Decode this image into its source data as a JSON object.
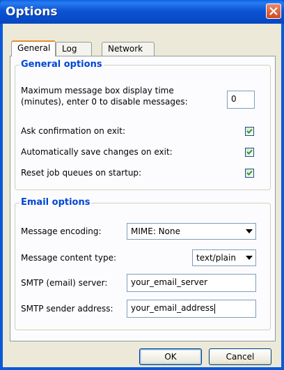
{
  "window": {
    "title": "Options"
  },
  "tabs": [
    {
      "label": "General",
      "active": true
    },
    {
      "label": "Log",
      "active": false
    },
    {
      "label": "Network",
      "active": false
    }
  ],
  "general_options": {
    "title": "General options",
    "max_display_label_line1": "Maximum message box display time",
    "max_display_label_line2": "(minutes), enter 0 to disable messages:",
    "max_display_value": "0",
    "ask_confirmation_label": "Ask confirmation on exit:",
    "ask_confirmation_checked": true,
    "autosave_label": "Automatically save changes on exit:",
    "autosave_checked": true,
    "reset_queues_label": "Reset job queues on startup:",
    "reset_queues_checked": true
  },
  "email_options": {
    "title": "Email options",
    "encoding_label": "Message encoding:",
    "encoding_value": "MIME: None",
    "content_type_label": "Message content type:",
    "content_type_value": "text/plain",
    "smtp_server_label": "SMTP (email) server:",
    "smtp_server_value": "your_email_server",
    "sender_label": "SMTP sender address:",
    "sender_value": "your_email_address"
  },
  "buttons": {
    "ok": "OK",
    "cancel": "Cancel"
  },
  "colors": {
    "title_bar": "#0a5ad8",
    "group_title": "#0046d5",
    "close_button": "#d4471f",
    "active_tab_highlight": "#e68b2c"
  }
}
